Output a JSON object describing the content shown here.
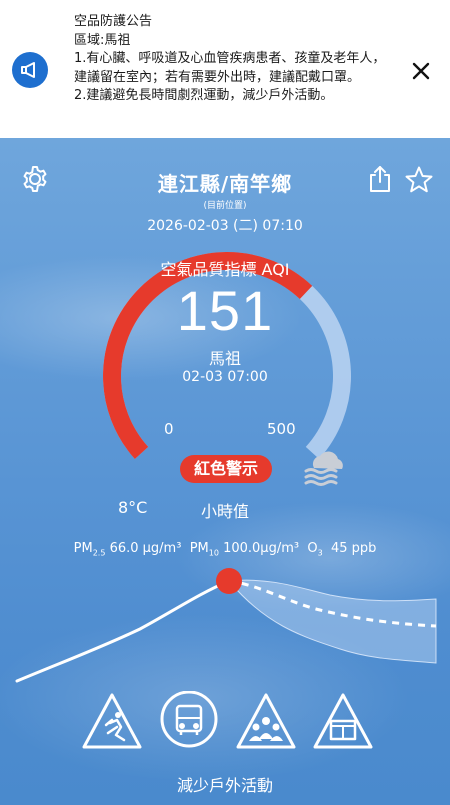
{
  "banner": {
    "title": "空品防護公告",
    "region": "區域:馬祖",
    "line1": "1.有心臟、呼吸道及心血管疾病患者、孩童及老年人，建議留在室內；若有需要外出時，建議配戴口罩。",
    "line2": "2.建議避免長時間劇烈運動，減少戶外活動。",
    "icon": "megaphone-icon",
    "close_icon": "close-icon"
  },
  "header": {
    "location": "連江縣/南竿鄉",
    "current_position": "(目前位置)",
    "datetime": "2026-02-03 (二) 07:10"
  },
  "aqi": {
    "label": "空氣品質指標 AQI",
    "value": "151",
    "numeric_value": 151,
    "max": 500,
    "station": "馬祖",
    "observed": "02-03 07:00",
    "scale_min": "0",
    "scale_max": "500",
    "alert": "紅色警示",
    "alert_color": "#e63a2c"
  },
  "weather": {
    "icon": "fog-icon",
    "temperature": "8°C",
    "mode": "小時值"
  },
  "pollutants": {
    "pm25_label": "PM",
    "pm25_sub": "2.5",
    "pm25_value": "66.0 μg/m³",
    "pm10_label": "PM",
    "pm10_sub": "10",
    "pm10_value": "100.0μg/m³",
    "o3_label": "O",
    "o3_sub": "3",
    "o3_value": "45 ppb"
  },
  "advice": {
    "icons": [
      "running-warning-icon",
      "bus-icon",
      "group-warning-icon",
      "window-warning-icon"
    ],
    "text": "減少戶外活動"
  },
  "colors": {
    "banner_accent": "#1e6fcf",
    "alert_red": "#e63a2c"
  }
}
